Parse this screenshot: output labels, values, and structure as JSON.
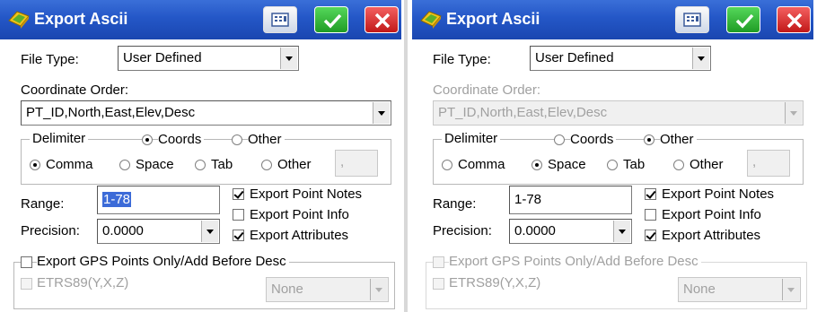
{
  "left": {
    "title": "Export Ascii",
    "file_type_label": "File Type:",
    "file_type_value": "User Defined",
    "coord_order_label": "Coordinate Order:",
    "coord_order_value": "PT_ID,North,East,Elev,Desc",
    "delimiter_label": "Delimiter",
    "coords_label": "Coords",
    "other_label": "Other",
    "comma_label": "Comma",
    "space_label": "Space",
    "tab_label": "Tab",
    "other2_label": "Other",
    "other_value": ",",
    "range_label": "Range:",
    "range_value": "1-78",
    "precision_label": "Precision:",
    "precision_value": "0.0000",
    "export_point_notes": "Export Point Notes",
    "export_point_info": "Export Point Info",
    "export_attributes": "Export Attributes",
    "gps_only_label": "Export GPS Points Only/Add Before Desc",
    "etrs_label": "ETRS89(Y,X,Z)",
    "none_value": "None"
  },
  "right": {
    "title": "Export Ascii",
    "file_type_label": "File Type:",
    "file_type_value": "User Defined",
    "coord_order_label": "Coordinate Order:",
    "coord_order_value": "PT_ID,North,East,Elev,Desc",
    "delimiter_label": "Delimiter",
    "coords_label": "Coords",
    "other_label": "Other",
    "comma_label": "Comma",
    "space_label": "Space",
    "tab_label": "Tab",
    "other2_label": "Other",
    "other_value": ",",
    "range_label": "Range:",
    "range_value": "1-78",
    "precision_label": "Precision:",
    "precision_value": "0.0000",
    "export_point_notes": "Export Point Notes",
    "export_point_info": "Export Point Info",
    "export_attributes": "Export Attributes",
    "gps_only_label": "Export GPS Points Only/Add Before Desc",
    "etrs_label": "ETRS89(Y,X,Z)",
    "none_value": "None"
  },
  "colors": {
    "titlebar": "#2457c7",
    "ok": "#1f9c25",
    "close": "#c11818",
    "disabled_text": "#a0a0a0"
  }
}
